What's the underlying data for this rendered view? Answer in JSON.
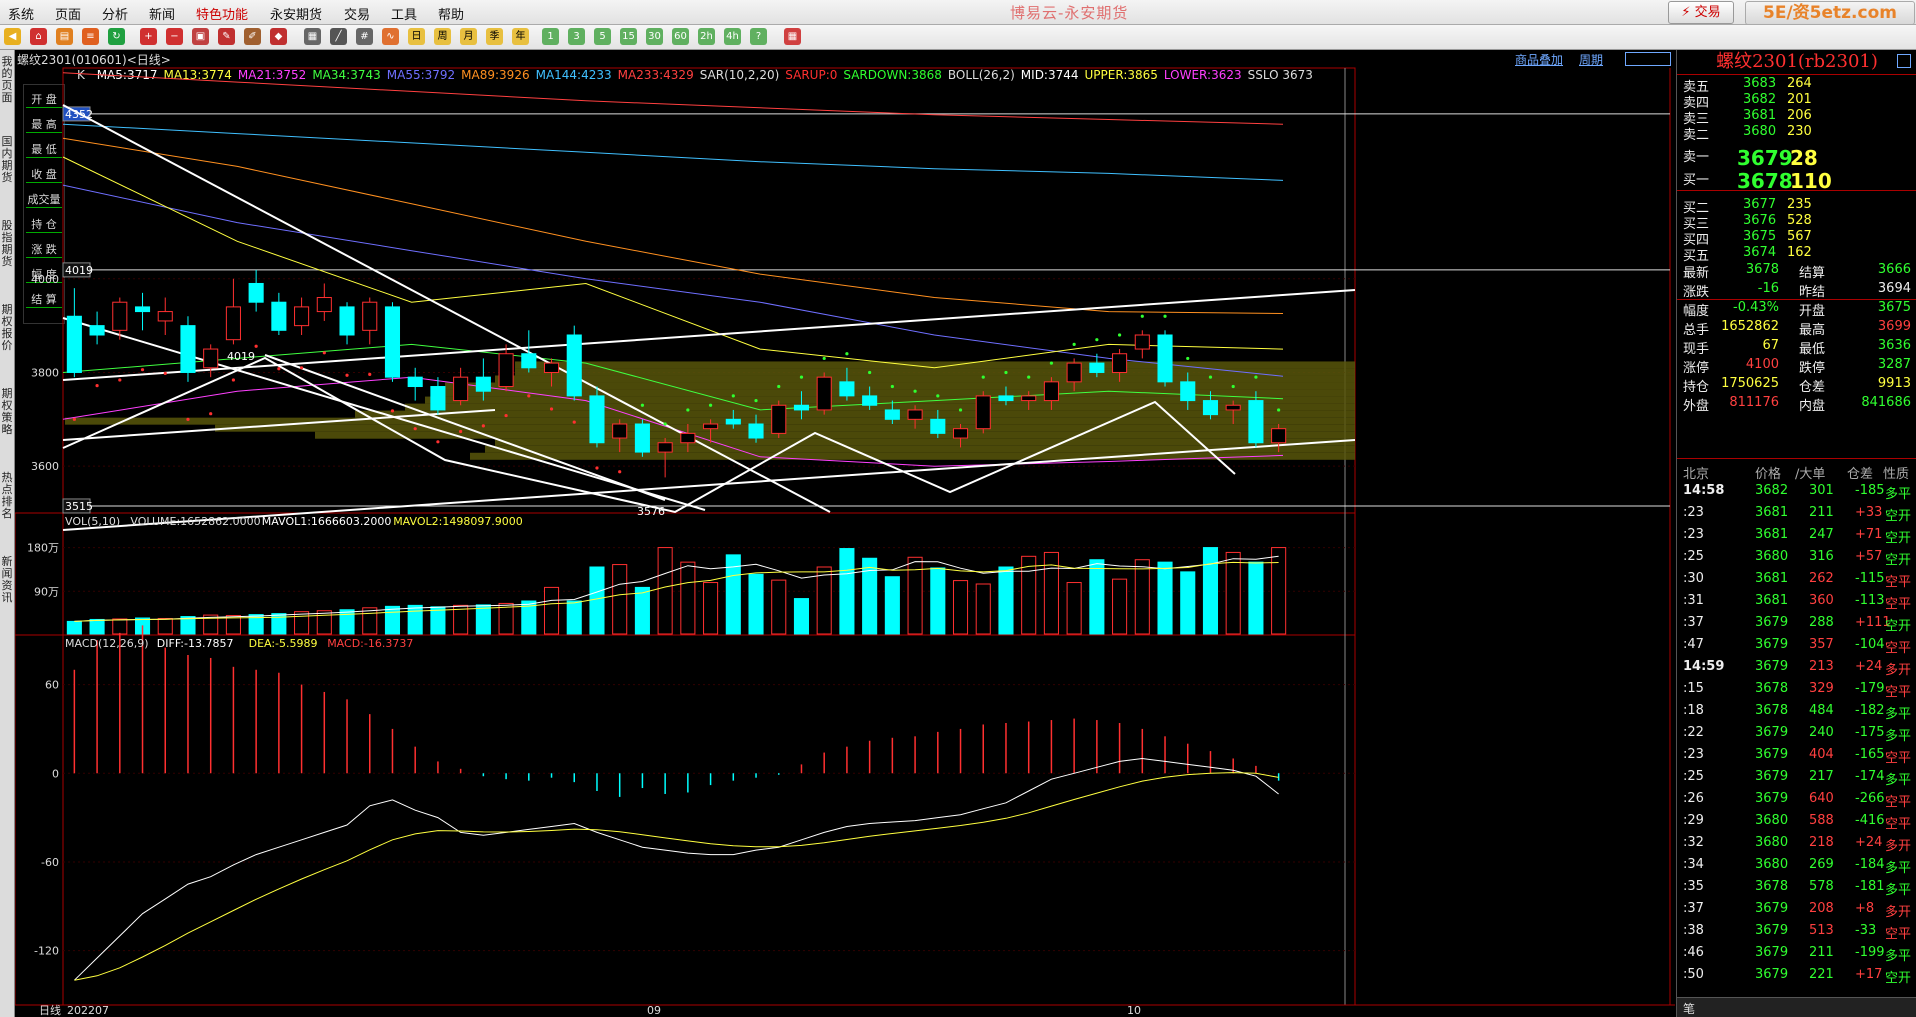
{
  "menu": {
    "items": [
      "系统",
      "页面",
      "分析",
      "新闻",
      "特色功能",
      "永安期货",
      "交易",
      "工具",
      "帮助"
    ],
    "app_title": "博易云-永安期货",
    "trade_button": "⚡ 交易",
    "site_badge": "5E/资5etz.com"
  },
  "sidebar": {
    "tabs": [
      "我的页面",
      "国内期货",
      "股指期货",
      "期权报价",
      "期权策略",
      "热点排名",
      "新闻资讯"
    ]
  },
  "chart": {
    "instrument": "螺纹2301(010601)<日线>",
    "link_add": "商品叠加",
    "link_period": "周期",
    "ohlc_labels": [
      "开 盘",
      "最 高",
      "最 低",
      "收 盘",
      "成交量",
      "持 仓",
      "涨 跌",
      "幅 度",
      "结 算"
    ],
    "price_ticks": [
      "4000",
      "3800",
      "3600"
    ],
    "price_marks": [
      "4352",
      "4019",
      "3515"
    ],
    "peak_labels": [
      "4019",
      "3576"
    ],
    "indicator_k": "K",
    "ma_labels": [
      {
        "text": "MA5:3717",
        "color": "#ffffff"
      },
      {
        "text": "MA13:3774",
        "color": "#ffff40"
      },
      {
        "text": "MA21:3752",
        "color": "#ff40ff"
      },
      {
        "text": "MA34:3743",
        "color": "#40ff40"
      },
      {
        "text": "MA55:3792",
        "color": "#6f6fff"
      },
      {
        "text": "MA89:3926",
        "color": "#ff9020"
      },
      {
        "text": "MA144:4233",
        "color": "#40c0ff"
      },
      {
        "text": "MA233:4329",
        "color": "#ff4040"
      },
      {
        "text": "SAR(10,2,20)",
        "color": "#dddddd"
      },
      {
        "text": "SARUP:0",
        "color": "#ff3030"
      },
      {
        "text": "SARDOWN:3868",
        "color": "#30ff30"
      },
      {
        "text": "BOLL(26,2)",
        "color": "#dddddd"
      },
      {
        "text": "MID:3744",
        "color": "#ffffff"
      },
      {
        "text": "UPPER:3865",
        "color": "#ffff40"
      },
      {
        "text": "LOWER:3623",
        "color": "#ff40ff"
      },
      {
        "text": "SSLO 3673",
        "color": "#dddddd"
      }
    ],
    "vol_labels": [
      {
        "text": "VOL(5,10)",
        "color": "#dddddd"
      },
      {
        "text": "VOLUME:1652862.0000",
        "color": "#dddddd"
      },
      {
        "text": "MAVOL1:1666603.2000",
        "color": "#ffffff"
      },
      {
        "text": "MAVOL2:1498097.9000",
        "color": "#ffff40"
      }
    ],
    "vol_ticks": [
      "180万",
      "90万"
    ],
    "macd_labels": [
      {
        "text": "MACD(12,26,9)",
        "color": "#dddddd"
      },
      {
        "text": "DIFF:-13.7857",
        "color": "#ffffff"
      },
      {
        "text": "DEA:-5.5989",
        "color": "#ffff40"
      },
      {
        "text": "MACD:-16.3737",
        "color": "#ff4040"
      }
    ],
    "macd_ticks": [
      "60",
      "0",
      "-60",
      "-120"
    ],
    "x_labels": [
      "日线",
      "202207",
      "09",
      "10"
    ]
  },
  "chart_data": {
    "type": "candlestick",
    "candles": [
      {
        "o": 3920,
        "h": 3980,
        "l": 3790,
        "c": 3800
      },
      {
        "o": 3900,
        "h": 3930,
        "l": 3860,
        "c": 3880
      },
      {
        "o": 3890,
        "h": 3960,
        "l": 3870,
        "c": 3950
      },
      {
        "o": 3940,
        "h": 3970,
        "l": 3890,
        "c": 3930
      },
      {
        "o": 3910,
        "h": 3960,
        "l": 3880,
        "c": 3930
      },
      {
        "o": 3900,
        "h": 3920,
        "l": 3780,
        "c": 3800
      },
      {
        "o": 3810,
        "h": 3860,
        "l": 3790,
        "c": 3850
      },
      {
        "o": 3870,
        "h": 4000,
        "l": 3860,
        "c": 3940
      },
      {
        "o": 3990,
        "h": 4019,
        "l": 3930,
        "c": 3950
      },
      {
        "o": 3950,
        "h": 3970,
        "l": 3880,
        "c": 3890
      },
      {
        "o": 3900,
        "h": 3960,
        "l": 3880,
        "c": 3940
      },
      {
        "o": 3930,
        "h": 3990,
        "l": 3910,
        "c": 3960
      },
      {
        "o": 3940,
        "h": 3950,
        "l": 3860,
        "c": 3880
      },
      {
        "o": 3890,
        "h": 3960,
        "l": 3860,
        "c": 3950
      },
      {
        "o": 3940,
        "h": 3950,
        "l": 3780,
        "c": 3790
      },
      {
        "o": 3790,
        "h": 3810,
        "l": 3740,
        "c": 3770
      },
      {
        "o": 3770,
        "h": 3790,
        "l": 3710,
        "c": 3720
      },
      {
        "o": 3740,
        "h": 3810,
        "l": 3730,
        "c": 3790
      },
      {
        "o": 3790,
        "h": 3830,
        "l": 3740,
        "c": 3760
      },
      {
        "o": 3770,
        "h": 3860,
        "l": 3760,
        "c": 3840
      },
      {
        "o": 3840,
        "h": 3890,
        "l": 3800,
        "c": 3810
      },
      {
        "o": 3800,
        "h": 3830,
        "l": 3770,
        "c": 3820
      },
      {
        "o": 3880,
        "h": 3900,
        "l": 3740,
        "c": 3750
      },
      {
        "o": 3750,
        "h": 3770,
        "l": 3640,
        "c": 3650
      },
      {
        "o": 3660,
        "h": 3700,
        "l": 3630,
        "c": 3690
      },
      {
        "o": 3690,
        "h": 3700,
        "l": 3620,
        "c": 3630
      },
      {
        "o": 3630,
        "h": 3660,
        "l": 3576,
        "c": 3650
      },
      {
        "o": 3650,
        "h": 3690,
        "l": 3630,
        "c": 3670
      },
      {
        "o": 3680,
        "h": 3700,
        "l": 3650,
        "c": 3690
      },
      {
        "o": 3700,
        "h": 3720,
        "l": 3680,
        "c": 3690
      },
      {
        "o": 3690,
        "h": 3710,
        "l": 3650,
        "c": 3660
      },
      {
        "o": 3670,
        "h": 3740,
        "l": 3660,
        "c": 3730
      },
      {
        "o": 3730,
        "h": 3760,
        "l": 3700,
        "c": 3720
      },
      {
        "o": 3720,
        "h": 3800,
        "l": 3710,
        "c": 3790
      },
      {
        "o": 3780,
        "h": 3810,
        "l": 3740,
        "c": 3750
      },
      {
        "o": 3750,
        "h": 3770,
        "l": 3720,
        "c": 3730
      },
      {
        "o": 3720,
        "h": 3740,
        "l": 3690,
        "c": 3700
      },
      {
        "o": 3700,
        "h": 3730,
        "l": 3680,
        "c": 3720
      },
      {
        "o": 3700,
        "h": 3720,
        "l": 3660,
        "c": 3670
      },
      {
        "o": 3660,
        "h": 3690,
        "l": 3640,
        "c": 3680
      },
      {
        "o": 3680,
        "h": 3760,
        "l": 3670,
        "c": 3750
      },
      {
        "o": 3750,
        "h": 3770,
        "l": 3730,
        "c": 3740
      },
      {
        "o": 3740,
        "h": 3760,
        "l": 3720,
        "c": 3750
      },
      {
        "o": 3740,
        "h": 3790,
        "l": 3720,
        "c": 3780
      },
      {
        "o": 3780,
        "h": 3830,
        "l": 3760,
        "c": 3820
      },
      {
        "o": 3820,
        "h": 3840,
        "l": 3790,
        "c": 3800
      },
      {
        "o": 3800,
        "h": 3850,
        "l": 3780,
        "c": 3840
      },
      {
        "o": 3850,
        "h": 3890,
        "l": 3830,
        "c": 3880
      },
      {
        "o": 3880,
        "h": 3890,
        "l": 3770,
        "c": 3780
      },
      {
        "o": 3780,
        "h": 3800,
        "l": 3720,
        "c": 3740
      },
      {
        "o": 3740,
        "h": 3760,
        "l": 3700,
        "c": 3710
      },
      {
        "o": 3720,
        "h": 3740,
        "l": 3690,
        "c": 3730
      },
      {
        "o": 3740,
        "h": 3760,
        "l": 3640,
        "c": 3650
      },
      {
        "o": 3650,
        "h": 3690,
        "l": 3630,
        "c": 3680
      }
    ],
    "volume_wan": [
      28,
      32,
      33,
      35,
      34,
      38,
      41,
      40,
      42,
      44,
      48,
      50,
      52,
      56,
      59,
      61,
      58,
      61,
      62,
      65,
      70,
      98,
      70,
      140,
      145,
      98,
      180,
      150,
      108,
      165,
      125,
      113,
      75,
      140,
      178,
      158,
      120,
      160,
      138,
      112,
      105,
      140,
      162,
      170,
      108,
      155,
      115,
      155,
      150,
      130,
      180,
      170,
      150,
      180,
      160
    ],
    "macd_hist": [
      70,
      90,
      95,
      100,
      85,
      80,
      78,
      72,
      70,
      68,
      60,
      55,
      50,
      40,
      30,
      18,
      8,
      3,
      -2,
      -4,
      -5,
      -3,
      -6,
      -12,
      -16,
      -10,
      -14,
      -13,
      -8,
      -5,
      -3,
      -1,
      6,
      14,
      18,
      22,
      24,
      25,
      28,
      30,
      33,
      34,
      35,
      36,
      37,
      36,
      34,
      30,
      25,
      20,
      15,
      10,
      5,
      -5
    ],
    "axis": {
      "ylim_price": [
        3500,
        4450
      ],
      "ylim_vol_wan": [
        0,
        210
      ],
      "ylim_macd": [
        -150,
        80
      ]
    }
  },
  "quote": {
    "title": "螺纹2301(rb2301)",
    "asks": [
      {
        "label": "卖五",
        "price": "3683",
        "vol": "264"
      },
      {
        "label": "卖四",
        "price": "3682",
        "vol": "201"
      },
      {
        "label": "卖三",
        "price": "3681",
        "vol": "206"
      },
      {
        "label": "卖二",
        "price": "3680",
        "vol": "230"
      },
      {
        "label": "卖一",
        "price": "3679",
        "vol": "28"
      }
    ],
    "bids": [
      {
        "label": "买一",
        "price": "3678",
        "vol": "110"
      },
      {
        "label": "买二",
        "price": "3677",
        "vol": "235"
      },
      {
        "label": "买三",
        "price": "3676",
        "vol": "528"
      },
      {
        "label": "买四",
        "price": "3675",
        "vol": "567"
      },
      {
        "label": "买五",
        "price": "3674",
        "vol": "162"
      }
    ],
    "stats": [
      {
        "l1": "最新",
        "v1": "3678",
        "c1": "green",
        "l2": "结算",
        "v2": "3666",
        "c2": "green"
      },
      {
        "l1": "涨跌",
        "v1": "-16",
        "c1": "green",
        "l2": "昨结",
        "v2": "3694",
        "c2": "white"
      },
      {
        "l1": "幅度",
        "v1": "-0.43%",
        "c1": "green",
        "l2": "开盘",
        "v2": "3675",
        "c2": "green"
      },
      {
        "l1": "总手",
        "v1": "1652862",
        "c1": "yellow",
        "l2": "最高",
        "v2": "3699",
        "c2": "red"
      },
      {
        "l1": "现手",
        "v1": "67",
        "c1": "yellow",
        "l2": "最低",
        "v2": "3636",
        "c2": "green"
      },
      {
        "l1": "涨停",
        "v1": "4100",
        "c1": "red",
        "l2": "跌停",
        "v2": "3287",
        "c2": "green"
      },
      {
        "l1": "持仓",
        "v1": "1750625",
        "c1": "yellow",
        "l2": "仓差",
        "v2": "9913",
        "c2": "yellow"
      },
      {
        "l1": "外盘",
        "v1": "811176",
        "c1": "red",
        "l2": "内盘",
        "v2": "841686",
        "c2": "green"
      }
    ],
    "tick_header": [
      "北京",
      "价格",
      "∕大单",
      "仓差",
      "性质"
    ],
    "ticks": [
      {
        "t": "14:58",
        "p": "3682",
        "v": "301",
        "d": "-185",
        "n": "多平",
        "nc": "green"
      },
      {
        "t": ":23",
        "p": "3681",
        "v": "211",
        "d": "+33",
        "n": "空开",
        "nc": "green"
      },
      {
        "t": ":23",
        "p": "3681",
        "v": "247",
        "d": "+71",
        "n": "空开",
        "nc": "green"
      },
      {
        "t": ":25",
        "p": "3680",
        "v": "316",
        "d": "+57",
        "n": "空开",
        "nc": "green"
      },
      {
        "t": ":30",
        "p": "3681",
        "v": "262",
        "d": "-115",
        "n": "空平",
        "nc": "red"
      },
      {
        "t": ":31",
        "p": "3681",
        "v": "360",
        "d": "-113",
        "n": "空平",
        "nc": "red"
      },
      {
        "t": ":37",
        "p": "3679",
        "v": "288",
        "d": "+111",
        "n": "空开",
        "nc": "green"
      },
      {
        "t": ":47",
        "p": "3679",
        "v": "357",
        "d": "-104",
        "n": "空平",
        "nc": "red"
      },
      {
        "t": "14:59",
        "p": "3679",
        "v": "213",
        "d": "+24",
        "n": "多开",
        "nc": "red"
      },
      {
        "t": ":15",
        "p": "3678",
        "v": "329",
        "d": "-179",
        "n": "空平",
        "nc": "red"
      },
      {
        "t": ":18",
        "p": "3678",
        "v": "484",
        "d": "-182",
        "n": "多平",
        "nc": "green"
      },
      {
        "t": ":22",
        "p": "3679",
        "v": "240",
        "d": "-175",
        "n": "多平",
        "nc": "green"
      },
      {
        "t": ":23",
        "p": "3679",
        "v": "404",
        "d": "-165",
        "n": "空平",
        "nc": "red"
      },
      {
        "t": ":25",
        "p": "3679",
        "v": "217",
        "d": "-174",
        "n": "多平",
        "nc": "green"
      },
      {
        "t": ":26",
        "p": "3679",
        "v": "640",
        "d": "-266",
        "n": "空平",
        "nc": "red"
      },
      {
        "t": ":29",
        "p": "3680",
        "v": "588",
        "d": "-416",
        "n": "空平",
        "nc": "red"
      },
      {
        "t": ":32",
        "p": "3680",
        "v": "218",
        "d": "+24",
        "n": "多开",
        "nc": "red"
      },
      {
        "t": ":34",
        "p": "3680",
        "v": "269",
        "d": "-184",
        "n": "多平",
        "nc": "green"
      },
      {
        "t": ":35",
        "p": "3678",
        "v": "578",
        "d": "-181",
        "n": "多平",
        "nc": "green"
      },
      {
        "t": ":37",
        "p": "3679",
        "v": "208",
        "d": "+8",
        "n": "多开",
        "nc": "red"
      },
      {
        "t": ":38",
        "p": "3679",
        "v": "513",
        "d": "-33",
        "n": "空平",
        "nc": "red"
      },
      {
        "t": ":46",
        "p": "3679",
        "v": "211",
        "d": "-199",
        "n": "多平",
        "nc": "green"
      },
      {
        "t": ":50",
        "p": "3679",
        "v": "221",
        "d": "+17",
        "n": "空开",
        "nc": "green"
      }
    ],
    "footer": "笔"
  }
}
